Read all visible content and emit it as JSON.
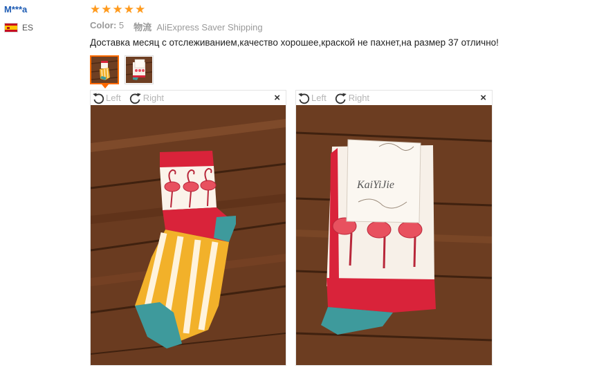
{
  "reviewer": {
    "name": "M***a",
    "country": "ES"
  },
  "rating": {
    "stars": 5,
    "max": 5
  },
  "meta": {
    "color_label": "Color:",
    "color_value": "5",
    "shipping_label": "物流",
    "shipping_value": "AliExpress Saver Shipping"
  },
  "review": {
    "text": "Доставка месяц с отслеживанием,качество хорошее,краской не пахнет,на размер 37 отлично!"
  },
  "viewers": [
    {
      "left_label": "Left",
      "right_label": "Right",
      "close": "×"
    },
    {
      "left_label": "Left",
      "right_label": "Right",
      "close": "×"
    }
  ],
  "product_tag": {
    "brand": "KaiYiJie"
  },
  "colors": {
    "star": "#ff9a1d",
    "name": "#1d5bb3",
    "thumb_active": "#ff6a00"
  }
}
